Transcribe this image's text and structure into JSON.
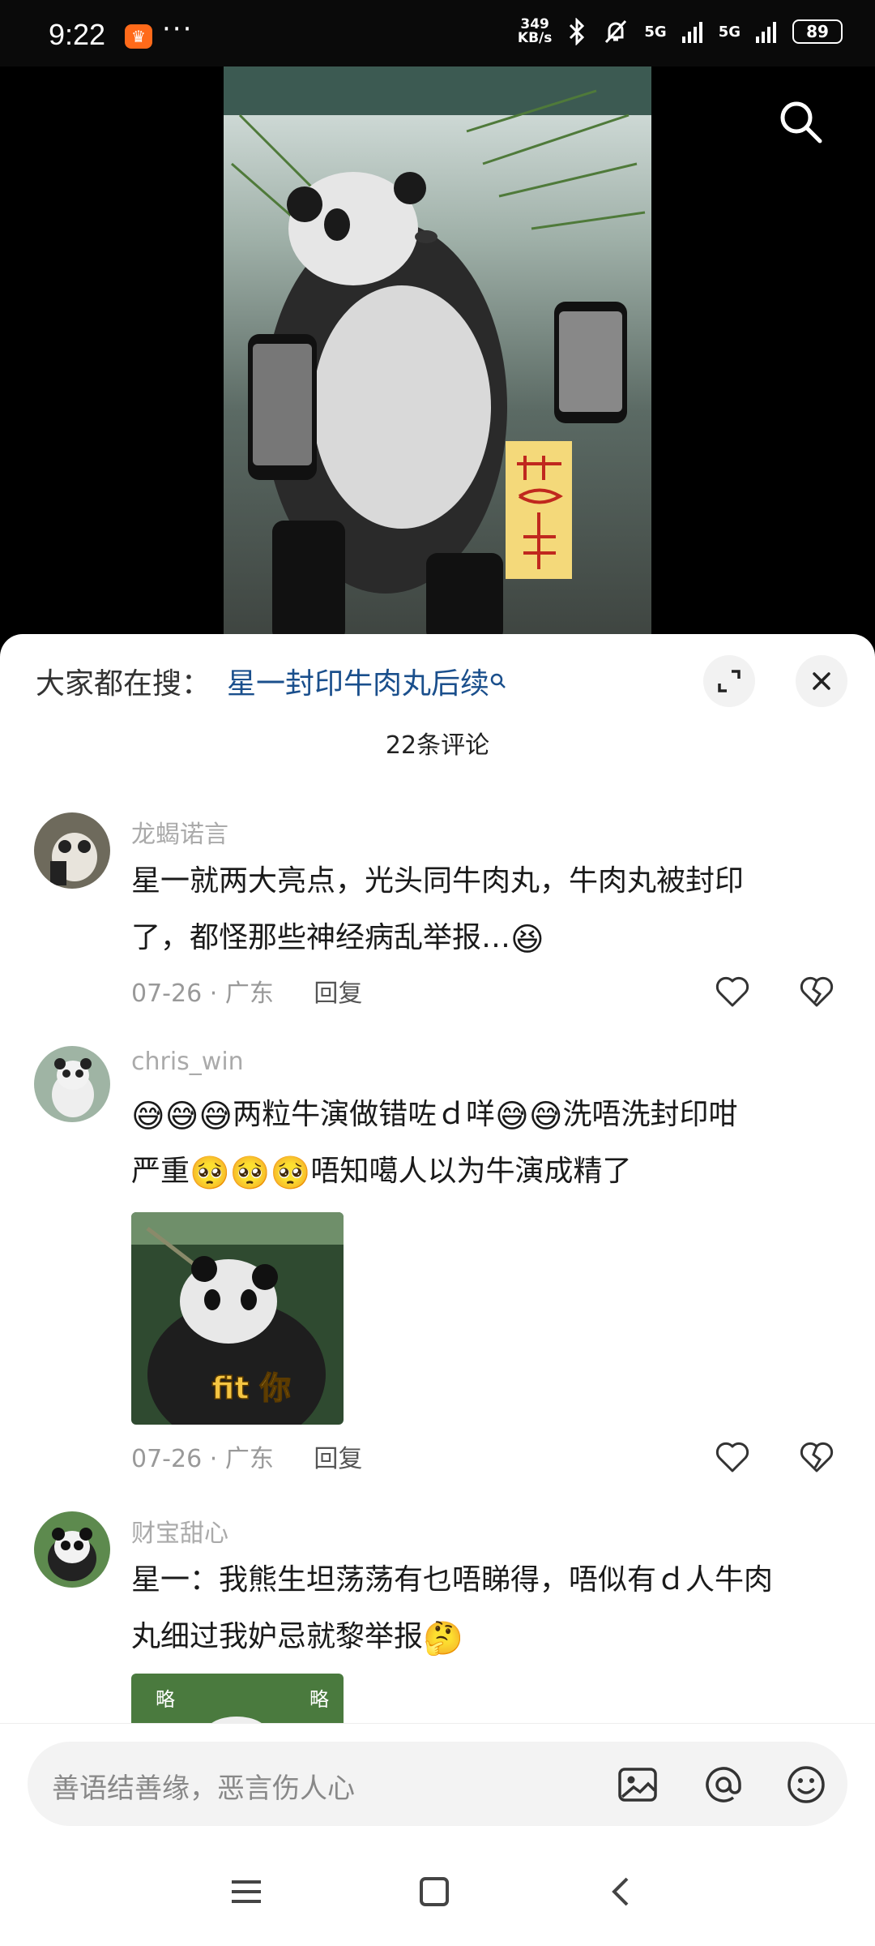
{
  "status_bar": {
    "time": "9:22",
    "app_badge": "♛",
    "more": "···",
    "net_speed_value": "349",
    "net_speed_unit": "KB/s",
    "sig1": "5G",
    "sig2": "5G",
    "battery": "89"
  },
  "sticker_text": "fit 你",
  "sticker3_text_left": "略",
  "sticker3_text_right": "略",
  "sheet": {
    "hot_label": "大家都在搜：",
    "hot_link": "星一封印牛肉丸后续",
    "count": "22条评论"
  },
  "comments": [
    {
      "user": "龙蝎诺言",
      "text_line1": "星一就两大亮点，光头同牛肉丸，牛肉丸被封印",
      "text_line2": "了，都怪那些神经病乱举报…",
      "emoji_end": "😆",
      "date": "07-26",
      "sep": "·",
      "region": "广东",
      "reply": "回复"
    },
    {
      "user": "chris_win",
      "emoji_a": "😅😅😅",
      "text_a": "两粒牛演做错咗ｄ咩",
      "emoji_b": "😅😅",
      "text_b": "洗唔洗封印咁",
      "text_c": "严重",
      "emoji_c": "🥺🥺🥺",
      "text_d": "唔知噶人以为牛演成精了",
      "date": "07-26",
      "sep": "·",
      "region": "广东",
      "reply": "回复"
    },
    {
      "user": "财宝甜心",
      "text_line1": "星一：我熊生坦荡荡有乜唔睇得，唔似有ｄ人牛肉",
      "text_line2": "丸细过我妒忌就黎举报",
      "emoji_end": "🤔"
    }
  ],
  "input": {
    "placeholder": "善语结善缘，恶言伤人心"
  },
  "colors": {
    "link": "#1a4f8c",
    "meta": "#999999",
    "app_badge": "#ff6a1a"
  }
}
